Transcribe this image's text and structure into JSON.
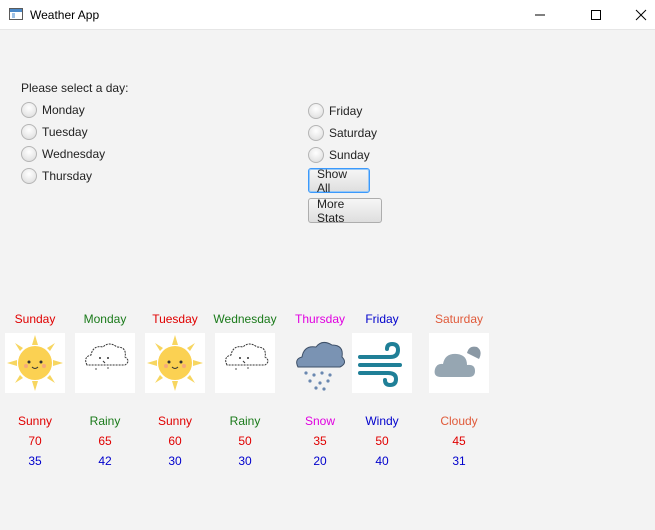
{
  "window": {
    "title": "Weather App"
  },
  "selector": {
    "prompt": "Please select a day:",
    "days_left": [
      "Monday",
      "Tuesday",
      "Wednesday",
      "Thursday"
    ],
    "days_right": [
      "Friday",
      "Saturday",
      "Sunday"
    ],
    "show_all_label": "Show All",
    "more_stats_label": "More Stats"
  },
  "forecast": [
    {
      "day": "Sunday",
      "condition": "Sunny",
      "high": "70",
      "low": "35",
      "color": "#e00000",
      "icon": "sun-icon"
    },
    {
      "day": "Monday",
      "condition": "Rainy",
      "high": "65",
      "low": "42",
      "color": "#1a7a1a",
      "icon": "rain-cloud-icon"
    },
    {
      "day": "Tuesday",
      "condition": "Sunny",
      "high": "60",
      "low": "30",
      "color": "#e00000",
      "icon": "sun-icon"
    },
    {
      "day": "Wednesday",
      "condition": "Rainy",
      "high": "50",
      "low": "30",
      "color": "#1a7a1a",
      "icon": "rain-cloud-icon"
    },
    {
      "day": "Thursday",
      "condition": "Snow",
      "high": "35",
      "low": "20",
      "color": "#e000e0",
      "icon": "snow-cloud-icon"
    },
    {
      "day": "Friday",
      "condition": "Windy",
      "high": "50",
      "low": "40",
      "color": "#0000cc",
      "icon": "wind-icon"
    },
    {
      "day": "Saturday",
      "condition": "Cloudy",
      "high": "45",
      "low": "31",
      "color": "#e05a3a",
      "icon": "cloud-icon"
    }
  ]
}
